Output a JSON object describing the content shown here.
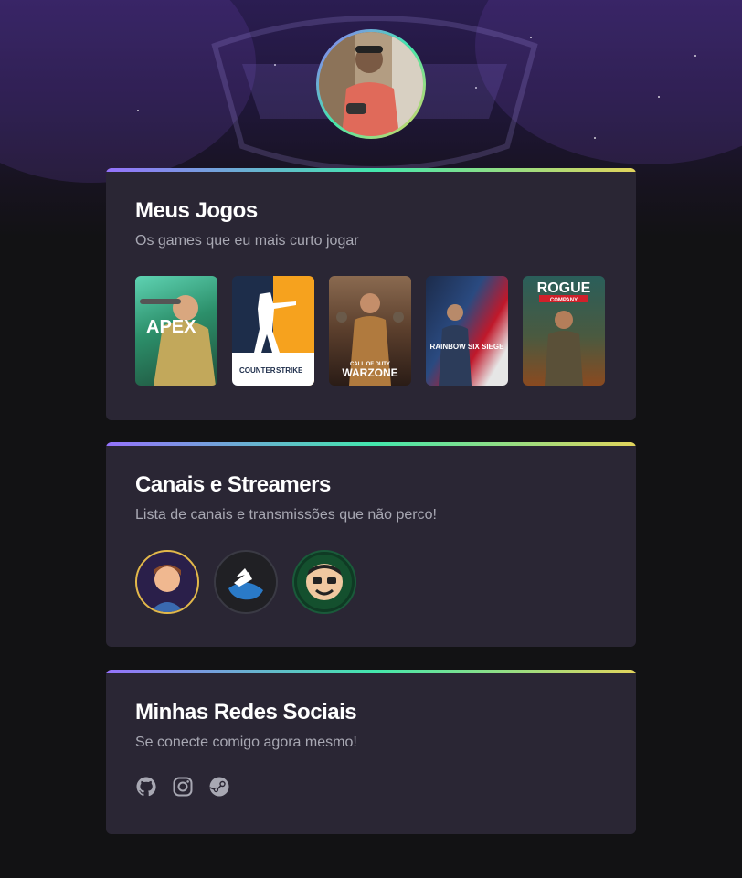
{
  "games_card": {
    "title": "Meus Jogos",
    "subtitle": "Os games que eu mais curto jogar",
    "games": [
      {
        "label": "APEX"
      },
      {
        "label": "COUNTER STRIKE"
      },
      {
        "label": "WARZONE"
      },
      {
        "label": "RAINBOW SIX SIEGE"
      },
      {
        "label": "ROGUE COMPANY"
      }
    ]
  },
  "channels_card": {
    "title": "Canais e Streamers",
    "subtitle": "Lista de canais e transmissões que não perco!"
  },
  "social_card": {
    "title": "Minhas Redes Sociais",
    "subtitle": "Se conecte comigo agora mesmo!"
  },
  "colors": {
    "background": "#121214",
    "card": "#2a2634",
    "gradient": [
      "#9572fc",
      "#43e7ad",
      "#e2d45c"
    ],
    "title": "#ffffff",
    "subtitle": "#a8a8b3"
  }
}
